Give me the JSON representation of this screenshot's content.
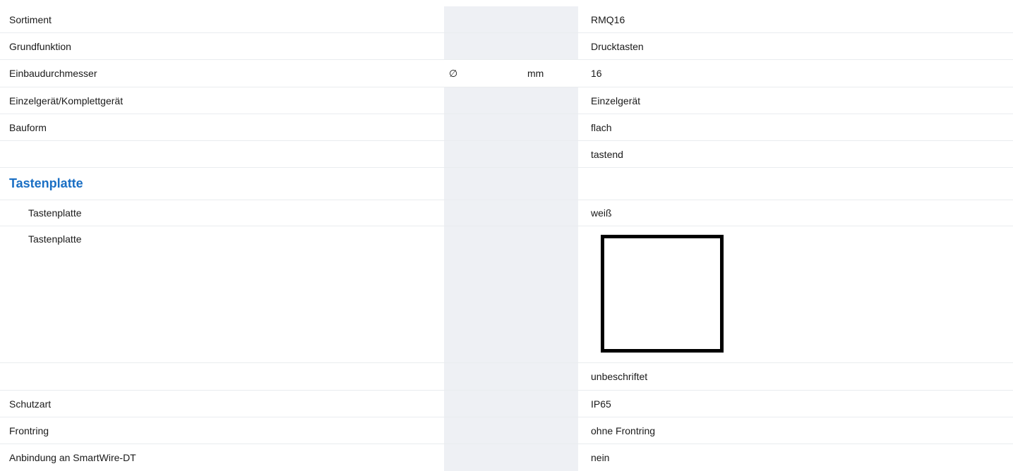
{
  "top_heading": "",
  "rows": [
    {
      "label": "Sortiment",
      "value": "RMQ16"
    },
    {
      "label": "Grundfunktion",
      "value": "Drucktasten"
    },
    {
      "label": "Einbaudurchmesser",
      "symbol": "∅",
      "unit": "mm",
      "value": "16"
    },
    {
      "label": "Einzelgerät/Komplettgerät",
      "value": "Einzelgerät"
    },
    {
      "label": "Bauform",
      "value": "flach"
    },
    {
      "label": "",
      "value": "tastend"
    }
  ],
  "section": {
    "title": "Tastenplatte"
  },
  "sub_rows": [
    {
      "label": "Tastenplatte",
      "value": "weiß"
    },
    {
      "label": "Tastenplatte",
      "value": "",
      "swatch_color": "#ffffff"
    },
    {
      "label": "",
      "value": "unbeschriftet"
    }
  ],
  "tail_rows": [
    {
      "label": "Schutzart",
      "value": "IP65"
    },
    {
      "label": "Frontring",
      "value": "ohne Frontring"
    },
    {
      "label": "Anbindung an SmartWire-DT",
      "value": "nein"
    }
  ],
  "colors": {
    "accent": "#1a6fc4",
    "shade": "#eef0f4",
    "border": "#e9ecef"
  }
}
